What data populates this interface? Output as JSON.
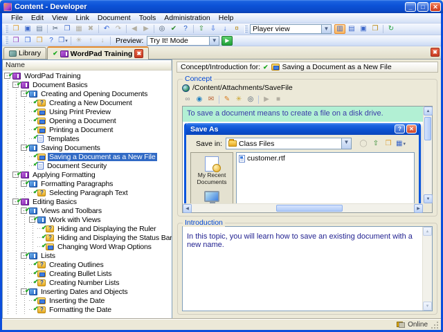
{
  "window": {
    "title": "Content - Developer"
  },
  "menu": {
    "items": [
      "File",
      "Edit",
      "View",
      "Link",
      "Document",
      "Tools",
      "Administration",
      "Help"
    ]
  },
  "toolbar1": {
    "buttons": [
      {
        "name": "open-button",
        "glyph": "❒",
        "color": "#D99A2B"
      },
      {
        "name": "save-button",
        "glyph": "▣",
        "color": "#3A66C9"
      },
      {
        "name": "print-button",
        "glyph": "▤",
        "color": "#6A7F99"
      },
      {
        "sep": true
      },
      {
        "name": "cut-button",
        "glyph": "✂",
        "color": "#44566B"
      },
      {
        "name": "copy-button",
        "glyph": "❐",
        "color": "#3A66C9"
      },
      {
        "name": "paste-button",
        "glyph": "▦",
        "color": "#A9A598",
        "disabled": true
      },
      {
        "name": "delete-button",
        "glyph": "✖",
        "color": "#C05A4A",
        "disabled": true
      },
      {
        "sep": true
      },
      {
        "name": "undo-button",
        "glyph": "↶",
        "color": "#2E62D9"
      },
      {
        "name": "redo-button",
        "glyph": "↷",
        "disabled": true
      },
      {
        "sep": true
      },
      {
        "name": "back-button",
        "glyph": "◀",
        "disabled": true
      },
      {
        "name": "forward-button",
        "glyph": "▶",
        "disabled": true
      },
      {
        "sep": true
      },
      {
        "name": "find-button",
        "glyph": "◎",
        "color": "#44566B"
      },
      {
        "name": "spell-check-button",
        "glyph": "✔",
        "color": "#2E8B2E"
      },
      {
        "name": "help-button",
        "glyph": "?",
        "color": "#1B54C8"
      },
      {
        "sep": true
      },
      {
        "name": "check-out-button",
        "glyph": "⇧",
        "color": "#2E8B2E"
      },
      {
        "name": "check-in-button",
        "glyph": "⇩",
        "color": "#2E62D9"
      },
      {
        "name": "get-latest-button",
        "glyph": "↓",
        "color": "#2E62D9"
      },
      {
        "name": "permissions-button",
        "glyph": "¤",
        "color": "#B8860B"
      }
    ],
    "player_view_value": "Player view",
    "view_buttons": [
      {
        "name": "view-outline-button",
        "glyph": "▥",
        "color": "#3A66C9",
        "active": true
      },
      {
        "name": "view-split-button",
        "glyph": "▤",
        "color": "#3A66C9"
      },
      {
        "name": "view-pages-button",
        "glyph": "▣",
        "color": "#3A66C9"
      },
      {
        "name": "view-properties-button",
        "glyph": "❐",
        "color": "#B8860B"
      },
      {
        "sep": true
      },
      {
        "name": "refresh-button",
        "glyph": "↻",
        "color": "#1FA037"
      }
    ]
  },
  "toolbar2": {
    "buttons": [
      {
        "name": "new-module-button",
        "glyph": "❒",
        "color": "#8E2FB8"
      },
      {
        "name": "new-section-button",
        "glyph": "❒",
        "color": "#2E62D9"
      },
      {
        "name": "new-topic-button",
        "glyph": "❒",
        "color": "#D99A2B"
      },
      {
        "name": "new-question-button",
        "glyph": "?",
        "color": "#2E62D9"
      },
      {
        "name": "new-item-dropdown-button",
        "glyph": "❐",
        "color": "#3A66C9",
        "dropdown": true
      },
      {
        "sep": true
      },
      {
        "name": "format-button",
        "glyph": "✳",
        "disabled": true
      },
      {
        "name": "move-up-button",
        "glyph": "↑",
        "disabled": true
      },
      {
        "name": "move-down-button",
        "glyph": "↓",
        "disabled": true
      }
    ],
    "preview_label": "Preview:",
    "preview_mode_value": "Try It! Mode"
  },
  "tabs": {
    "library_label": "Library",
    "content_label": "WordPad Training"
  },
  "tree": {
    "header": "Name",
    "items": [
      {
        "label": "WordPad Training",
        "level": 0,
        "icon": "module",
        "parent": true
      },
      {
        "label": "Document Basics",
        "level": 1,
        "icon": "module",
        "parent": true
      },
      {
        "label": "Creating and Opening Documents",
        "level": 2,
        "icon": "section",
        "parent": true
      },
      {
        "label": "Creating a New Document",
        "level": 3,
        "icon": "topic_q"
      },
      {
        "label": "Using Print Preview",
        "level": 3,
        "icon": "topic_s"
      },
      {
        "label": "Opening a Document",
        "level": 3,
        "icon": "topic_s"
      },
      {
        "label": "Printing a Document",
        "level": 3,
        "icon": "topic_s"
      },
      {
        "label": "Templates",
        "level": 3,
        "icon": "doc"
      },
      {
        "label": "Saving Documents",
        "level": 2,
        "icon": "section",
        "parent": true
      },
      {
        "label": "Saving a Document as a New File",
        "level": 3,
        "icon": "topic_s",
        "selected": true
      },
      {
        "label": "Document Security",
        "level": 3,
        "icon": "doc"
      },
      {
        "label": "Applying Formatting",
        "level": 1,
        "icon": "module",
        "parent": true
      },
      {
        "label": "Formatting Paragraphs",
        "level": 2,
        "icon": "section",
        "parent": true
      },
      {
        "label": "Selecting Paragraph Text",
        "level": 3,
        "icon": "topic_q"
      },
      {
        "label": "Editing Basics",
        "level": 1,
        "icon": "module",
        "parent": true
      },
      {
        "label": "Views and Toolbars",
        "level": 2,
        "icon": "section",
        "parent": true
      },
      {
        "label": "Work with Views",
        "level": 3,
        "icon": "section",
        "parent": true
      },
      {
        "label": "Hiding and Displaying the Ruler",
        "level": 4,
        "icon": "topic_q"
      },
      {
        "label": "Hiding and Displaying the Status Bar",
        "level": 4,
        "icon": "topic_q"
      },
      {
        "label": "Changing Word Wrap Options",
        "level": 4,
        "icon": "topic_s"
      },
      {
        "label": "Lists",
        "level": 2,
        "icon": "section",
        "parent": true
      },
      {
        "label": "Creating Outlines",
        "level": 3,
        "icon": "topic_q"
      },
      {
        "label": "Creating Bullet Lists",
        "level": 3,
        "icon": "topic_s"
      },
      {
        "label": "Creating Number Lists",
        "level": 3,
        "icon": "topic_q"
      },
      {
        "label": "Inserting Dates and Objects",
        "level": 2,
        "icon": "section",
        "parent": true
      },
      {
        "label": "Inserting the Date",
        "level": 3,
        "icon": "topic_s"
      },
      {
        "label": "Formatting the Date",
        "level": 3,
        "icon": "topic_q"
      }
    ]
  },
  "right": {
    "context_header": {
      "prefix": "Concept/Introduction for:",
      "title": "Saving a Document as a New File"
    },
    "concept": {
      "label": "Concept",
      "attachment_path": "/Content/Attachments/SaveFile",
      "tools": [
        {
          "name": "link-button",
          "glyph": "∞",
          "color": "#8A8E94"
        },
        {
          "name": "browse-button",
          "glyph": "◉",
          "color": "#1F7FBF"
        },
        {
          "name": "package-button",
          "glyph": "✉",
          "color": "#B85C2E"
        },
        {
          "sep": true
        },
        {
          "name": "edit-button",
          "glyph": "✎",
          "color": "#D97B1F"
        },
        {
          "name": "settings-button",
          "glyph": "✳",
          "color": "#C9A227"
        },
        {
          "name": "preview-button",
          "glyph": "◎",
          "color": "#44566B"
        },
        {
          "sep": true
        },
        {
          "name": "play-button",
          "glyph": "▶",
          "disabled": true
        },
        {
          "name": "stop-button",
          "glyph": "■",
          "disabled": true
        }
      ],
      "banner_text": "To save a document means to create a file on a disk drive.",
      "dialog": {
        "title": "Save As",
        "help_glyph": "?",
        "save_in_label": "Save in:",
        "save_in_value": "Class Files",
        "nav_buttons": [
          {
            "name": "dialog-back-button",
            "glyph": "◯",
            "disabled": true
          },
          {
            "name": "dialog-up-level-button",
            "glyph": "⇧",
            "color": "#2E8B2E"
          },
          {
            "name": "dialog-new-folder-button",
            "glyph": "❒",
            "color": "#D99A2B"
          },
          {
            "name": "dialog-views-button",
            "glyph": "▦",
            "color": "#3A66C9",
            "dropdown": true
          }
        ],
        "places": [
          {
            "name": "my-recent-documents",
            "label": "My Recent Documents",
            "icon": "pic-recent"
          },
          {
            "name": "desktop",
            "label": "Desktop",
            "icon": "pic-desktop"
          }
        ],
        "files": [
          {
            "label": "customer.rtf"
          }
        ]
      }
    },
    "introduction": {
      "label": "Introduction",
      "text": "In this topic, you will learn how to save an existing document with a new name."
    }
  },
  "statusbar": {
    "online_label": "Online"
  },
  "colors": {
    "titlebar_blue": "#0B4EDC",
    "selection_blue": "#316AC5",
    "banner_teal": "#B2F0D4",
    "active_tab_orange": "#E68B2C",
    "groupbox_label_blue": "#0046D5"
  }
}
